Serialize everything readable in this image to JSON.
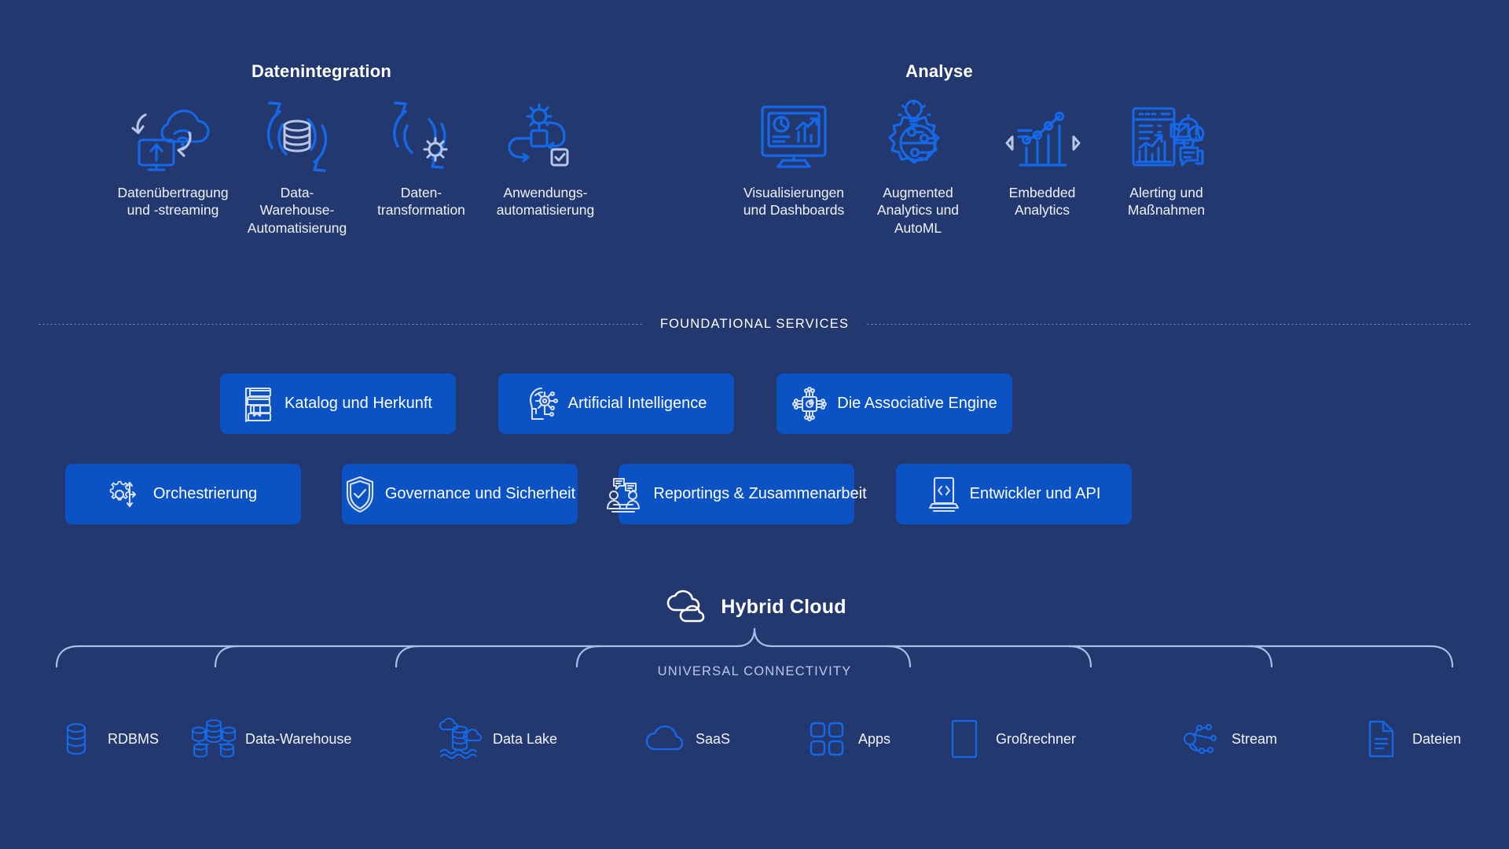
{
  "colors": {
    "background": "#23386e",
    "pill": "#0b52c4",
    "icon_blue": "#1569e8",
    "icon_light": "#b8c6e8",
    "text": "#ffffff",
    "muted": "#b9c9ee"
  },
  "groups": [
    {
      "title": "Datenintegration",
      "items": [
        {
          "icon": "data-transfer-streaming-icon",
          "label": "Datenübertragung\nund -streaming"
        },
        {
          "icon": "data-warehouse-automation-icon",
          "label": "Data-\nWarehouse-\nAutomatisierung"
        },
        {
          "icon": "data-transformation-icon",
          "label": "Daten-\ntransformation"
        },
        {
          "icon": "application-automation-icon",
          "label": "Anwendungs-\nautomatisierung"
        }
      ]
    },
    {
      "title": "Analyse",
      "items": [
        {
          "icon": "visualizations-dashboards-icon",
          "label": "Visualisierungen\nund Dashboards"
        },
        {
          "icon": "augmented-analytics-automl-icon",
          "label": "Augmented\nAnalytics und\nAutoML"
        },
        {
          "icon": "embedded-analytics-icon",
          "label": "Embedded\nAnalytics"
        },
        {
          "icon": "alerting-actions-icon",
          "label": "Alerting und\nMaßnahmen"
        }
      ]
    }
  ],
  "divider": {
    "label": "FOUNDATIONAL SERVICES"
  },
  "foundational_services": {
    "row1": [
      {
        "icon": "books-catalog-icon",
        "label": "Katalog und Herkunft"
      },
      {
        "icon": "ai-head-icon",
        "label": "Artificial Intelligence"
      },
      {
        "icon": "chip-engine-icon",
        "label": "Die Associative Engine"
      }
    ],
    "row2": [
      {
        "icon": "gear-orchestration-icon",
        "label": "Orchestrierung"
      },
      {
        "icon": "shield-check-icon",
        "label": "Governance und Sicherheit"
      },
      {
        "icon": "collaboration-icon",
        "label": "Reportings & Zusammenarbeit"
      },
      {
        "icon": "code-laptop-icon",
        "label": "Entwickler und API"
      }
    ]
  },
  "hybrid_cloud": {
    "icon": "cloud-icon",
    "label": "Hybrid Cloud"
  },
  "universal_connectivity": {
    "label": "UNIVERSAL CONNECTIVITY"
  },
  "sources": [
    {
      "icon": "database-icon",
      "label": "RDBMS"
    },
    {
      "icon": "data-warehouse-cluster-icon",
      "label": "Data-Warehouse"
    },
    {
      "icon": "data-lake-icon",
      "label": "Data Lake"
    },
    {
      "icon": "cloud-saas-icon",
      "label": "SaaS"
    },
    {
      "icon": "apps-grid-icon",
      "label": "Apps"
    },
    {
      "icon": "mainframe-icon",
      "label": "Großrechner"
    },
    {
      "icon": "stream-nodes-icon",
      "label": "Stream"
    },
    {
      "icon": "file-document-icon",
      "label": "Dateien"
    }
  ]
}
